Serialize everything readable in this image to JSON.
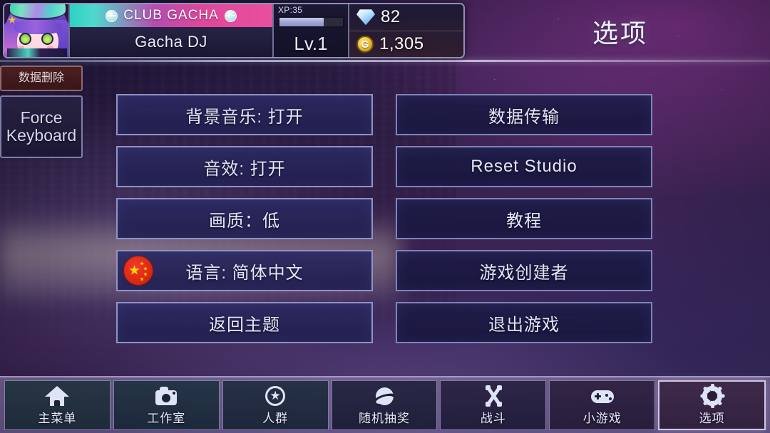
{
  "page": {
    "title": "选项"
  },
  "hud": {
    "avatar_name": "player-avatar",
    "club_name": "CLUB GACHA",
    "player_name": "Gacha DJ",
    "xp_label": "XP:35",
    "xp_percent": 70,
    "level": "Lv.1",
    "gems": "82",
    "gold": "1,305",
    "gold_symbol": "G"
  },
  "side_buttons": [
    {
      "label": "数据删除",
      "name": "delete-data-button"
    },
    {
      "label": "Force Keyboard",
      "name": "force-keyboard-button"
    }
  ],
  "options": {
    "left": [
      {
        "label": "背景音乐: 打开",
        "name": "bgm-toggle-button",
        "icon": null
      },
      {
        "label": "音效: 打开",
        "name": "sfx-toggle-button",
        "icon": null
      },
      {
        "label": "画质：低",
        "name": "quality-button",
        "icon": null
      },
      {
        "label": "语言: 简体中文",
        "name": "language-button",
        "icon": "china-flag-icon"
      },
      {
        "label": "返回主题",
        "name": "back-to-theme-button",
        "icon": null
      }
    ],
    "right": [
      {
        "label": "数据传输",
        "name": "data-transfer-button"
      },
      {
        "label": "Reset Studio",
        "name": "reset-studio-button"
      },
      {
        "label": "教程",
        "name": "tutorial-button"
      },
      {
        "label": "游戏创建者",
        "name": "game-credits-button"
      },
      {
        "label": "退出游戏",
        "name": "quit-game-button"
      }
    ]
  },
  "navbar": [
    {
      "label": "主菜单",
      "icon": "home-icon",
      "name": "nav-main-menu",
      "selected": false
    },
    {
      "label": "工作室",
      "icon": "camera-icon",
      "name": "nav-studio",
      "selected": false
    },
    {
      "label": "人群",
      "icon": "star-icon",
      "name": "nav-crowd",
      "selected": false
    },
    {
      "label": "随机抽奖",
      "icon": "gacha-ball-icon",
      "name": "nav-gacha",
      "selected": false
    },
    {
      "label": "战斗",
      "icon": "swords-icon",
      "name": "nav-battle",
      "selected": false
    },
    {
      "label": "小游戏",
      "icon": "gamepad-icon",
      "name": "nav-minigames",
      "selected": false
    },
    {
      "label": "选项",
      "icon": "gear-icon",
      "name": "nav-options",
      "selected": true
    }
  ],
  "colors": {
    "button_border": "#8f94c4",
    "button_fill": "#2b2960",
    "danger_border": "#8e6a70",
    "danger_fill": "#4a1f22",
    "flag_red": "#de2910",
    "flag_yellow": "#ffde00",
    "club_banner_teal": "#2dd2c4",
    "club_banner_pink": "#e84f9e"
  }
}
